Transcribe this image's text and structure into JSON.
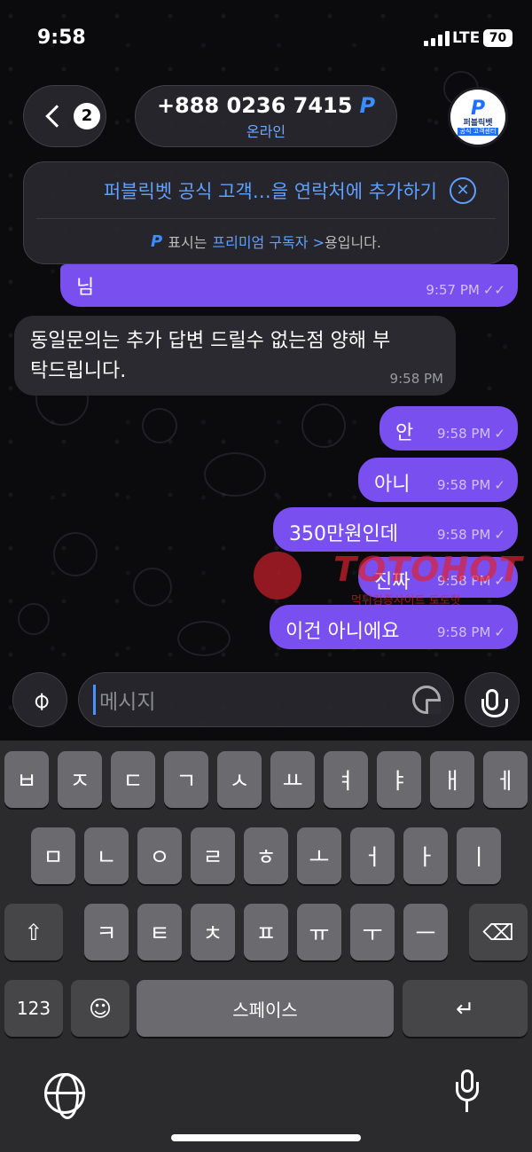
{
  "status_bar": {
    "time": "9:58",
    "network": "LTE",
    "battery": "70"
  },
  "header": {
    "back_count": "2",
    "title": "+888 0236 7415",
    "title_badge": "P",
    "subtitle": "온라인",
    "avatar": {
      "logo": "P",
      "line1": "퍼블릭벳",
      "line2": "공식 고객센터"
    }
  },
  "banner": {
    "add_contact": "퍼블릭벳 공식 고객…을 연락처에 추가하기",
    "premium_prefix": "표시는",
    "premium_link": "프리미엄 구독자 >",
    "premium_suffix": "용입니다.",
    "premium_badge": "P"
  },
  "messages": [
    {
      "direction": "out",
      "text": "님",
      "time": "9:57 PM",
      "status": "read"
    },
    {
      "direction": "in",
      "text_line1": "동일문의는 추가 답변 드릴수 없는점 양해 부",
      "text_line2": "탁드립니다.",
      "time": "9:58 PM"
    },
    {
      "direction": "out",
      "text": "안",
      "time": "9:58 PM",
      "status": "sent"
    },
    {
      "direction": "out",
      "text": "아니",
      "time": "9:58 PM",
      "status": "sent"
    },
    {
      "direction": "out",
      "text": "350만원인데",
      "time": "9:58 PM",
      "status": "sent"
    },
    {
      "direction": "out",
      "text": "진짜",
      "time": "9:58 PM",
      "status": "sent"
    },
    {
      "direction": "out",
      "text": "이건 아니에요",
      "time": "9:58 PM",
      "status": "sent"
    }
  ],
  "watermark": {
    "text": "TOTOHOT",
    "sub": "먹튀검증사이트 토토핫"
  },
  "composer": {
    "placeholder": "메시지"
  },
  "keyboard": {
    "row1": [
      "ㅂ",
      "ㅈ",
      "ㄷ",
      "ㄱ",
      "ㅅ",
      "ㅛ",
      "ㅕ",
      "ㅑ",
      "ㅐ",
      "ㅔ"
    ],
    "row2": [
      "ㅁ",
      "ㄴ",
      "ㅇ",
      "ㄹ",
      "ㅎ",
      "ㅗ",
      "ㅓ",
      "ㅏ",
      "ㅣ"
    ],
    "row3": [
      "ㅋ",
      "ㅌ",
      "ㅊ",
      "ㅍ",
      "ㅠ",
      "ㅜ",
      "ㅡ"
    ],
    "numbers": "123",
    "space": "스페이스",
    "shift_icon": "⇧",
    "delete_icon": "⌫",
    "return_icon": "↵",
    "emoji_icon": "☺"
  }
}
